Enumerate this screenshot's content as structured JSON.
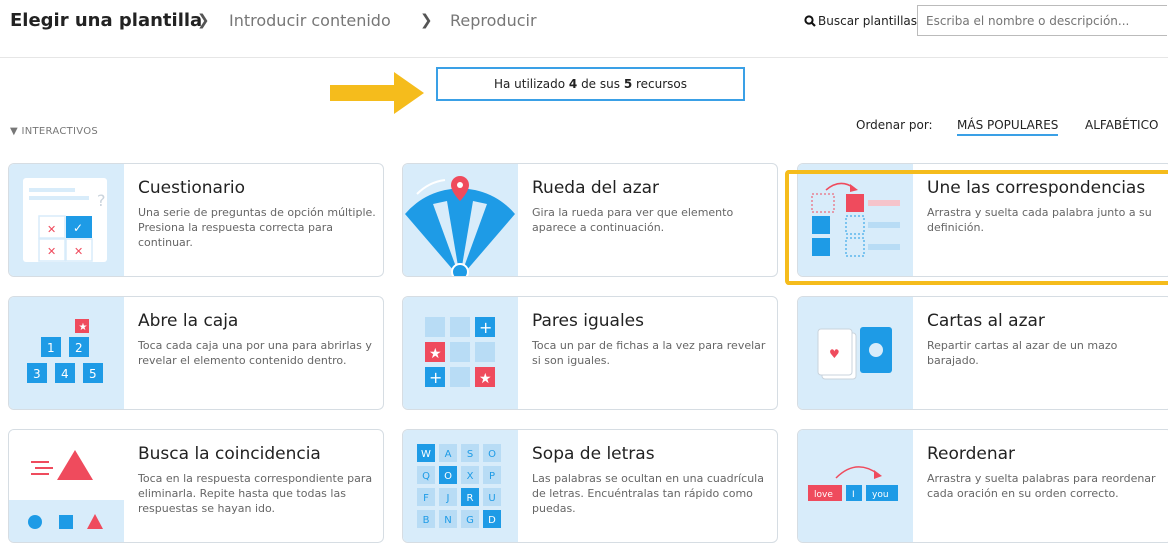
{
  "breadcrumb": {
    "step1": "Elegir una plantilla",
    "step2": "Introducir contenido",
    "step3": "Reproducir"
  },
  "search": {
    "label": "Buscar plantillas:",
    "placeholder": "Escriba el nombre o descripción..."
  },
  "usage": {
    "prefix": "Ha utilizado ",
    "used": "4",
    "middle": " de sus ",
    "total": "5",
    "suffix": " recursos"
  },
  "section": {
    "label": "INTERACTIVOS"
  },
  "sort": {
    "label": "Ordenar por:",
    "option1": "MÁS POPULARES",
    "option2": "ALFABÉTICO"
  },
  "colors": {
    "accent": "#3aa0e6",
    "highlight": "#f5bc1c",
    "thumb_bg": "#d8ecfa",
    "red": "#ef4b5d"
  },
  "templates": [
    {
      "title": "Cuestionario",
      "desc": "Una serie de preguntas de opción múltiple. Presiona la respuesta correcta para continuar.",
      "icon": "quiz-icon"
    },
    {
      "title": "Rueda del azar",
      "desc": "Gira la rueda para ver que elemento aparece a continuación.",
      "icon": "wheel-icon"
    },
    {
      "title": "Une las correspondencias",
      "desc": "Arrastra y suelta cada palabra junto a su definición.",
      "icon": "match-icon"
    },
    {
      "title": "Abre la caja",
      "desc": "Toca cada caja una por una para abrirlas y revelar el elemento contenido dentro.",
      "icon": "boxes-icon"
    },
    {
      "title": "Pares iguales",
      "desc": "Toca un par de fichas a la vez para revelar si son iguales.",
      "icon": "pairs-icon"
    },
    {
      "title": "Cartas al azar",
      "desc": "Repartir cartas al azar de un mazo barajado.",
      "icon": "cards-icon"
    },
    {
      "title": "Busca la coincidencia",
      "desc": "Toca en la respuesta correspondiente para eliminarla. Repite hasta que todas las respuestas se hayan ido.",
      "icon": "shapes-icon"
    },
    {
      "title": "Sopa de letras",
      "desc": "Las palabras se ocultan en una cuadrícula de letras. Encuéntralas tan rápido como puedas.",
      "icon": "wordsearch-icon"
    },
    {
      "title": "Reordenar",
      "desc": "Arrastra y suelta palabras para reordenar cada oración en su orden correcto.",
      "icon": "reorder-icon"
    }
  ],
  "icon_text": {
    "wordsearch": [
      "W",
      "A",
      "S",
      "O",
      "Q",
      "O",
      "X",
      "P",
      "F",
      "J",
      "R",
      "U",
      "B",
      "N",
      "G",
      "D"
    ],
    "reorder": [
      "love",
      "I",
      "you"
    ],
    "boxes": [
      "1",
      "2",
      "3",
      "4",
      "5"
    ]
  }
}
